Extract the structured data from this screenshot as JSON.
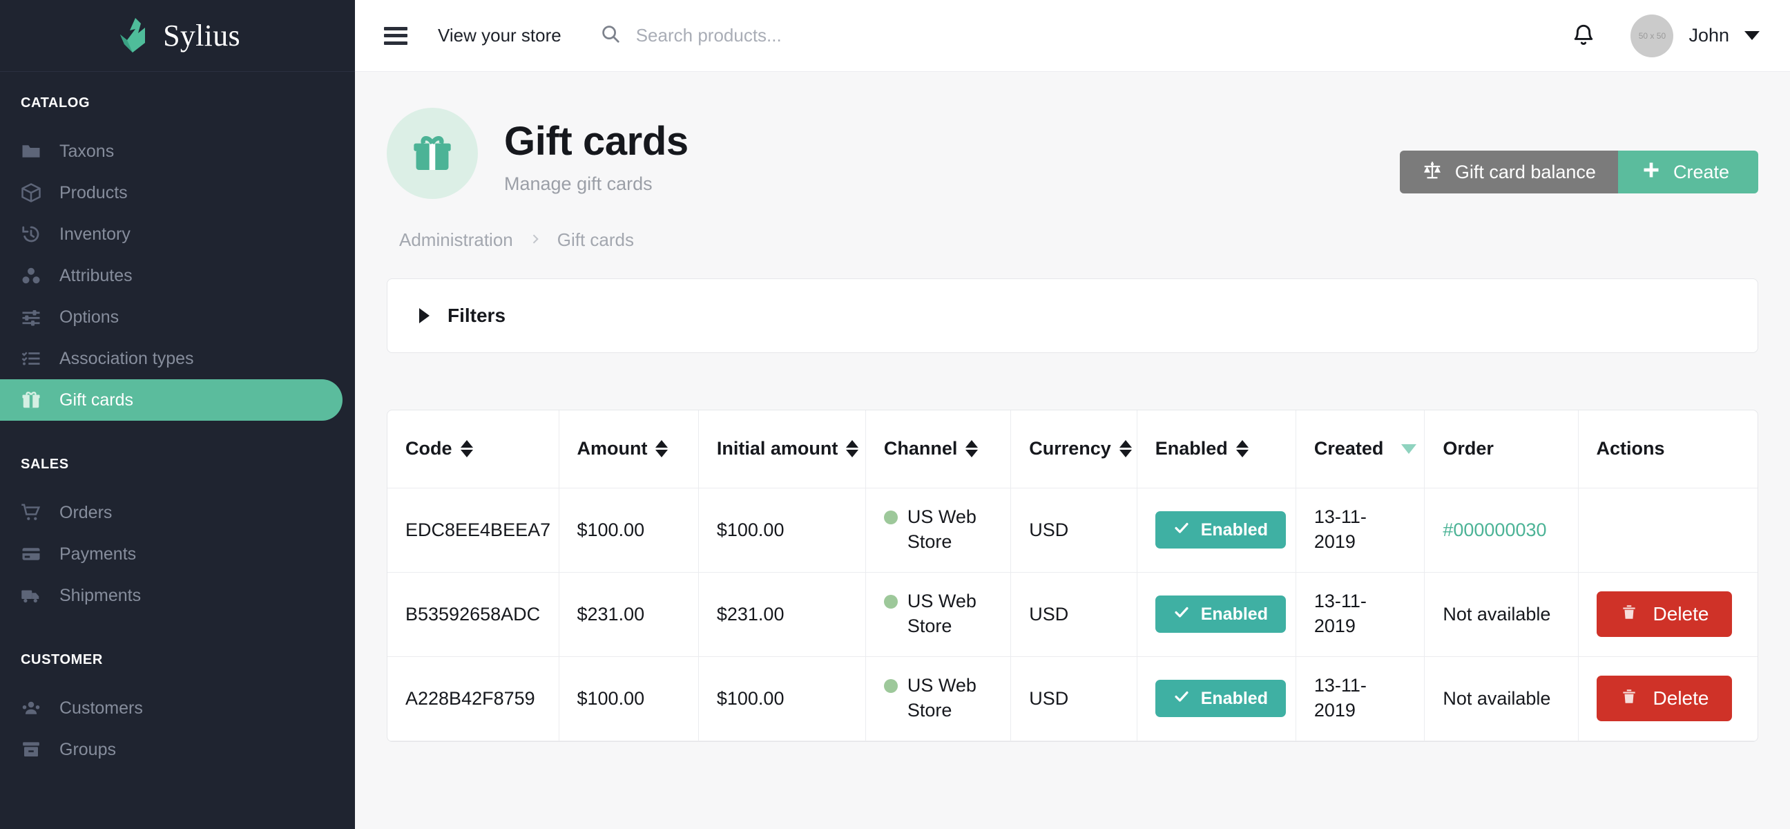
{
  "brand": {
    "name": "Sylius",
    "logo_icon": "swan-logo-icon"
  },
  "sidebar": {
    "sections": [
      {
        "title": "CATALOG",
        "items": [
          {
            "label": "Taxons",
            "icon": "folder-icon",
            "active": false
          },
          {
            "label": "Products",
            "icon": "box-icon",
            "active": false
          },
          {
            "label": "Inventory",
            "icon": "history-icon",
            "active": false
          },
          {
            "label": "Attributes",
            "icon": "blocks-icon",
            "active": false
          },
          {
            "label": "Options",
            "icon": "sliders-icon",
            "active": false
          },
          {
            "label": "Association types",
            "icon": "checklist-icon",
            "active": false
          },
          {
            "label": "Gift cards",
            "icon": "gift-icon",
            "active": true
          }
        ]
      },
      {
        "title": "SALES",
        "items": [
          {
            "label": "Orders",
            "icon": "cart-icon",
            "active": false
          },
          {
            "label": "Payments",
            "icon": "credit-card-icon",
            "active": false
          },
          {
            "label": "Shipments",
            "icon": "truck-icon",
            "active": false
          }
        ]
      },
      {
        "title": "CUSTOMER",
        "items": [
          {
            "label": "Customers",
            "icon": "users-icon",
            "active": false
          },
          {
            "label": "Groups",
            "icon": "box-archive-icon",
            "active": false
          }
        ]
      }
    ]
  },
  "topbar": {
    "menu_icon": "hamburger-icon",
    "view_store_label": "View your store",
    "search": {
      "icon": "search-icon",
      "value": "",
      "placeholder": "Search products..."
    },
    "notifications_icon": "bell-icon",
    "avatar_placeholder": "50 x 50",
    "user_name": "John",
    "user_caret_icon": "chevron-down-icon"
  },
  "page": {
    "icon": "gift-icon",
    "title": "Gift cards",
    "subtitle": "Manage gift cards",
    "actions": {
      "balance_label": "Gift card balance",
      "balance_icon": "scale-balance-icon",
      "create_label": "Create",
      "create_icon": "plus-icon"
    },
    "breadcrumb": [
      "Administration",
      "Gift cards"
    ],
    "filters_label": "Filters"
  },
  "table": {
    "columns": [
      {
        "label": "Code",
        "sortable": true,
        "sorted": null
      },
      {
        "label": "Amount",
        "sortable": true,
        "sorted": null
      },
      {
        "label": "Initial amount",
        "sortable": true,
        "sorted": null
      },
      {
        "label": "Channel",
        "sortable": true,
        "sorted": null
      },
      {
        "label": "Currency",
        "sortable": true,
        "sorted": null
      },
      {
        "label": "Enabled",
        "sortable": true,
        "sorted": null
      },
      {
        "label": "Created",
        "sortable": true,
        "sorted": "desc"
      },
      {
        "label": "Order",
        "sortable": false,
        "sorted": null
      },
      {
        "label": "Actions",
        "sortable": false,
        "sorted": null
      }
    ],
    "rows": [
      {
        "code": "EDC8EE4BEEA7",
        "amount": "$100.00",
        "initial_amount": "$100.00",
        "channel": "US Web Store",
        "currency": "USD",
        "enabled_label": "Enabled",
        "created": "13-11-2019",
        "order": "#000000030",
        "order_is_link": true,
        "has_delete": false,
        "delete_label": "Delete"
      },
      {
        "code": "B53592658ADC",
        "amount": "$231.00",
        "initial_amount": "$231.00",
        "channel": "US Web Store",
        "currency": "USD",
        "enabled_label": "Enabled",
        "created": "13-11-2019",
        "order": "Not available",
        "order_is_link": false,
        "has_delete": true,
        "delete_label": "Delete"
      },
      {
        "code": "A228B42F8759",
        "amount": "$100.00",
        "initial_amount": "$100.00",
        "channel": "US Web Store",
        "currency": "USD",
        "enabled_label": "Enabled",
        "created": "13-11-2019",
        "order": "Not available",
        "order_is_link": false,
        "has_delete": true,
        "delete_label": "Delete"
      }
    ]
  },
  "colors": {
    "sidebar_bg": "#1f2430",
    "accent_green": "#5bbc9d",
    "badge_teal": "#3fb0a3",
    "danger_red": "#cf3228",
    "link_green": "#4cb396",
    "gray_button": "#7b7b7b"
  }
}
